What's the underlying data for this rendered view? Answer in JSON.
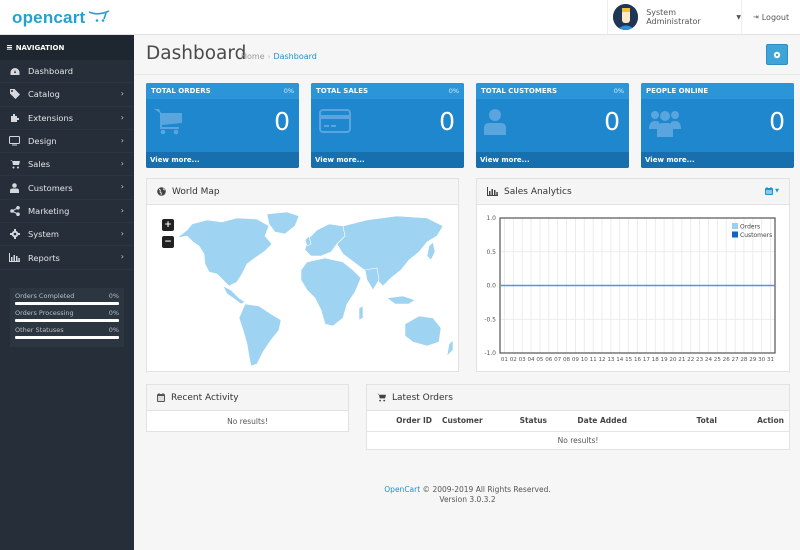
{
  "header": {
    "logo_text": "opencart",
    "user_name": "System Administrator",
    "logout_label": "Logout"
  },
  "sidebar": {
    "nav_title": "NAVIGATION",
    "items": [
      {
        "label": "Dashboard",
        "icon": "dashboard-icon",
        "has_children": false
      },
      {
        "label": "Catalog",
        "icon": "tags-icon",
        "has_children": true
      },
      {
        "label": "Extensions",
        "icon": "puzzle-icon",
        "has_children": true
      },
      {
        "label": "Design",
        "icon": "monitor-icon",
        "has_children": true
      },
      {
        "label": "Sales",
        "icon": "cart-icon",
        "has_children": true
      },
      {
        "label": "Customers",
        "icon": "user-icon",
        "has_children": true
      },
      {
        "label": "Marketing",
        "icon": "share-icon",
        "has_children": true
      },
      {
        "label": "System",
        "icon": "gear-icon",
        "has_children": true
      },
      {
        "label": "Reports",
        "icon": "bar-chart-icon",
        "has_children": true
      }
    ],
    "stats": [
      {
        "label": "Orders Completed",
        "value": "0%",
        "progress": 0
      },
      {
        "label": "Orders Processing",
        "value": "0%",
        "progress": 0
      },
      {
        "label": "Other Statuses",
        "value": "0%",
        "progress": 0
      }
    ]
  },
  "page": {
    "title": "Dashboard",
    "breadcrumb": [
      "Home",
      "Dashboard"
    ]
  },
  "tiles": [
    {
      "title": "TOTAL ORDERS",
      "percent": "0%",
      "value": "0",
      "link": "View more...",
      "icon": "cart-icon"
    },
    {
      "title": "TOTAL SALES",
      "percent": "0%",
      "value": "0",
      "link": "View more...",
      "icon": "credit-card-icon"
    },
    {
      "title": "TOTAL CUSTOMERS",
      "percent": "0%",
      "value": "0",
      "link": "View more...",
      "icon": "user-icon"
    },
    {
      "title": "PEOPLE ONLINE",
      "percent": "",
      "value": "0",
      "link": "View more...",
      "icon": "users-icon"
    }
  ],
  "world_map": {
    "title": "World Map",
    "zoom_in": "+",
    "zoom_out": "−"
  },
  "sales_analytics": {
    "title": "Sales Analytics"
  },
  "chart_data": {
    "type": "line",
    "title": "Sales Analytics",
    "x": [
      "01",
      "02",
      "03",
      "04",
      "05",
      "06",
      "07",
      "08",
      "09",
      "10",
      "11",
      "12",
      "13",
      "14",
      "15",
      "16",
      "17",
      "18",
      "19",
      "20",
      "21",
      "22",
      "23",
      "24",
      "25",
      "26",
      "27",
      "28",
      "29",
      "30",
      "31"
    ],
    "series": [
      {
        "name": "Orders",
        "color": "#9bd0f0",
        "values": [
          0,
          0,
          0,
          0,
          0,
          0,
          0,
          0,
          0,
          0,
          0,
          0,
          0,
          0,
          0,
          0,
          0,
          0,
          0,
          0,
          0,
          0,
          0,
          0,
          0,
          0,
          0,
          0,
          0,
          0,
          0
        ]
      },
      {
        "name": "Customers",
        "color": "#1065c0",
        "values": [
          0,
          0,
          0,
          0,
          0,
          0,
          0,
          0,
          0,
          0,
          0,
          0,
          0,
          0,
          0,
          0,
          0,
          0,
          0,
          0,
          0,
          0,
          0,
          0,
          0,
          0,
          0,
          0,
          0,
          0,
          0
        ]
      }
    ],
    "yticks": [
      "1.0",
      "0.5",
      "0.0",
      "-0.5",
      "-1.0"
    ],
    "ylim": [
      -1,
      1
    ],
    "grid": true,
    "legend": "top-right"
  },
  "recent_activity": {
    "title": "Recent Activity",
    "empty": "No results!"
  },
  "latest_orders": {
    "title": "Latest Orders",
    "columns": [
      "Order ID",
      "Customer",
      "Status",
      "Date Added",
      "Total",
      "Action"
    ],
    "empty": "No results!"
  },
  "footer": {
    "brand": "OpenCart",
    "copyright": " © 2009-2019 All Rights Reserved.",
    "version": "Version 3.0.3.2"
  }
}
